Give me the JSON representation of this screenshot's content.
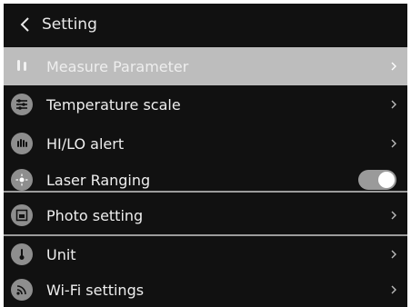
{
  "header": {
    "title": "Setting",
    "back_icon": "chevron-left-icon"
  },
  "menu": [
    {
      "label": "Measure Parameter",
      "icon": "thermometer-icon",
      "trailing": "chevron",
      "selected": true
    },
    {
      "label": "Temperature scale",
      "icon": "sliders-icon",
      "trailing": "chevron"
    },
    {
      "label": "HI/LO alert",
      "icon": "hand-icon",
      "trailing": "chevron"
    },
    {
      "label": "Laser Ranging",
      "icon": "laser-icon",
      "trailing": "toggle",
      "toggle_on": true
    },
    {
      "label": "Photo setting",
      "icon": "photo-icon",
      "trailing": "chevron"
    },
    {
      "label": "Unit",
      "icon": "unit-icon",
      "trailing": "chevron"
    },
    {
      "label": "Wi-Fi settings",
      "icon": "wifi-icon",
      "trailing": "chevron"
    }
  ],
  "colors": {
    "background": "#111111",
    "selected_row": "#bdbdbd",
    "icon_fill": "#8e8e8e",
    "toggle_track": "#9a9a9a"
  }
}
